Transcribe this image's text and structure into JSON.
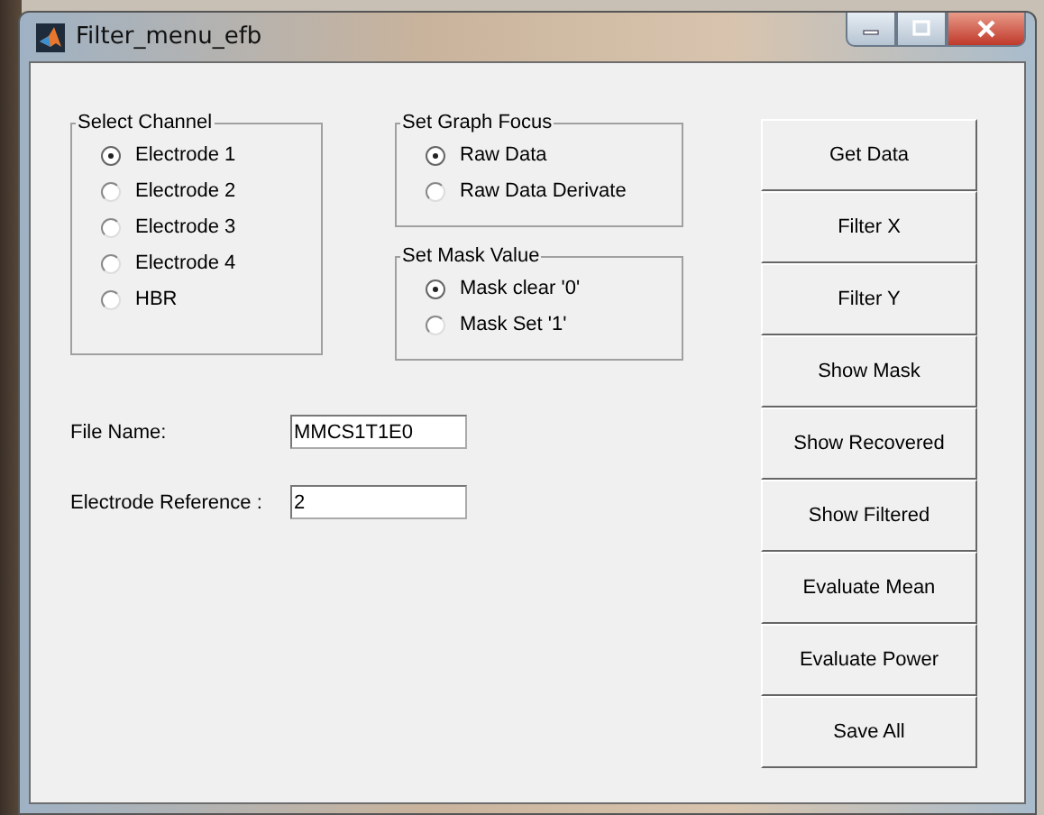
{
  "window": {
    "title": "Filter_menu_efb"
  },
  "channel_group": {
    "title": "Select Channel",
    "options": [
      {
        "label": "Electrode 1",
        "selected": true
      },
      {
        "label": "Electrode 2",
        "selected": false
      },
      {
        "label": "Electrode 3",
        "selected": false
      },
      {
        "label": "Electrode 4",
        "selected": false
      },
      {
        "label": "HBR",
        "selected": false
      }
    ]
  },
  "focus_group": {
    "title": "Set Graph Focus",
    "options": [
      {
        "label": "Raw Data",
        "selected": true
      },
      {
        "label": "Raw Data Derivate",
        "selected": false
      }
    ]
  },
  "mask_group": {
    "title": "Set Mask Value",
    "options": [
      {
        "label": "Mask clear '0'",
        "selected": true
      },
      {
        "label": "Mask Set '1'",
        "selected": false
      }
    ]
  },
  "fields": [
    {
      "label": "File Name:",
      "value": "MMCS1T1E0"
    },
    {
      "label": "Electrode Reference :",
      "value": "2"
    }
  ],
  "buttons": [
    "Get Data",
    "Filter X",
    "Filter Y",
    "Show Mask",
    "Show Recovered",
    "Show Filtered",
    "Evaluate Mean",
    "Evaluate Power",
    "Save All"
  ]
}
